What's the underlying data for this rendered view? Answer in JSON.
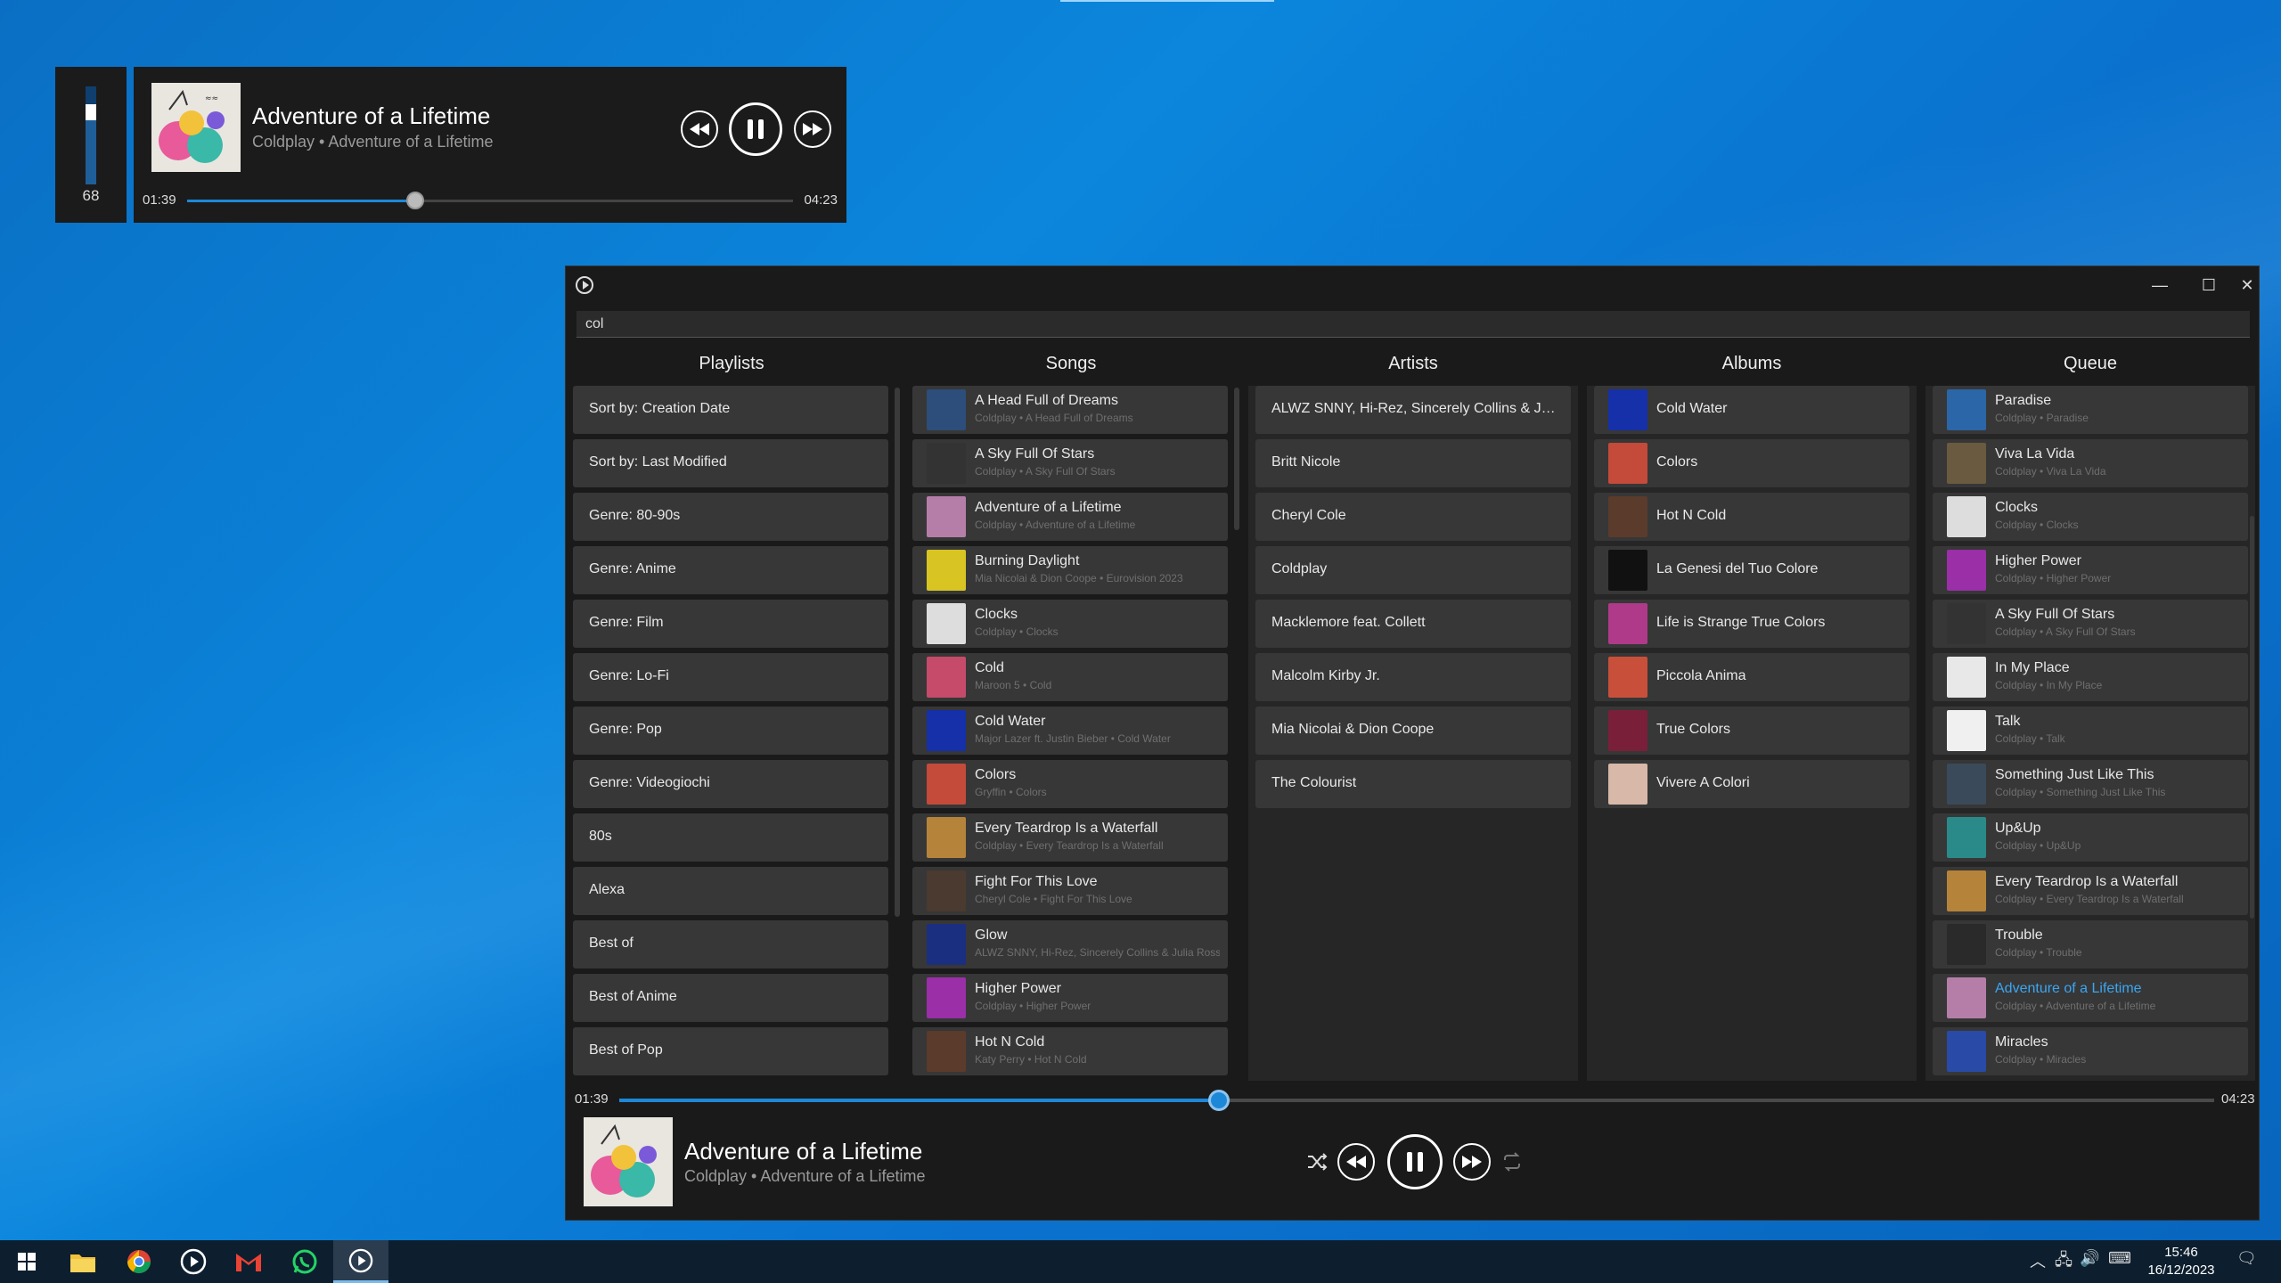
{
  "mini_player": {
    "volume": "68",
    "volume_level": 0.68,
    "title": "Adventure of a Lifetime",
    "subtitle": "Coldplay • Adventure of a Lifetime",
    "elapsed": "01:39",
    "duration": "04:23",
    "progress": 0.376
  },
  "window": {
    "search_value": "col",
    "minimize": "—",
    "maximize": "☐",
    "close": "✕"
  },
  "columns": {
    "playlists": "Playlists",
    "songs": "Songs",
    "artists": "Artists",
    "albums": "Albums",
    "queue": "Queue"
  },
  "playlists": [
    "Sort by: Creation Date",
    "Sort by: Last Modified",
    "Genre: 80-90s",
    "Genre: Anime",
    "Genre: Film",
    "Genre: Lo-Fi",
    "Genre: Pop",
    "Genre: Videogiochi",
    "80s",
    "Alexa",
    "Best of",
    "Best of Anime",
    "Best of Pop"
  ],
  "songs": [
    {
      "title": "A Head Full of Dreams",
      "sub": "Coldplay • A Head Full of Dreams",
      "color": "#2d4d7a"
    },
    {
      "title": "A Sky Full Of Stars",
      "sub": "Coldplay • A Sky Full Of Stars",
      "color": "#333"
    },
    {
      "title": "Adventure of a Lifetime",
      "sub": "Coldplay • Adventure of a Lifetime",
      "color": "#b57ea8"
    },
    {
      "title": "Burning Daylight",
      "sub": "Mia Nicolai & Dion Coope • Eurovision 2023",
      "color": "#d8c422"
    },
    {
      "title": "Clocks",
      "sub": "Coldplay • Clocks",
      "color": "#ddd"
    },
    {
      "title": "Cold",
      "sub": "Maroon 5 • Cold",
      "color": "#c64b6a"
    },
    {
      "title": "Cold Water",
      "sub": "Major Lazer ft. Justin Bieber • Cold Water",
      "color": "#1530a8"
    },
    {
      "title": "Colors",
      "sub": "Gryffin • Colors",
      "color": "#c44a3a"
    },
    {
      "title": "Every Teardrop Is a Waterfall",
      "sub": "Coldplay • Every Teardrop Is a Waterfall",
      "color": "#b5843a"
    },
    {
      "title": "Fight For This Love",
      "sub": "Cheryl Cole • Fight For This Love",
      "color": "#4a3a30"
    },
    {
      "title": "Glow",
      "sub": "ALWZ SNNY, Hi-Rez, Sincerely Collins & Julia Ross • Glow",
      "color": "#1b2f80"
    },
    {
      "title": "Higher Power",
      "sub": "Coldplay • Higher Power",
      "color": "#9a2fa8"
    },
    {
      "title": "Hot N Cold",
      "sub": "Katy Perry • Hot N Cold",
      "color": "#5b3b2b"
    }
  ],
  "artists": [
    "ALWZ SNNY, Hi-Rez, Sincerely Collins & Julia Ro...",
    "Britt Nicole",
    "Cheryl Cole",
    "Coldplay",
    "Macklemore feat. Collett",
    "Malcolm Kirby Jr.",
    "Mia Nicolai & Dion Coope",
    "The Colourist"
  ],
  "albums": [
    {
      "title": "Cold Water",
      "color": "#1530a8"
    },
    {
      "title": "Colors",
      "color": "#c44a3a"
    },
    {
      "title": "Hot N Cold",
      "color": "#5b3b2b"
    },
    {
      "title": "La Genesi del Tuo Colore",
      "color": "#111"
    },
    {
      "title": "Life is Strange True Colors",
      "color": "#b03a8a"
    },
    {
      "title": "Piccola Anima",
      "color": "#c8503a"
    },
    {
      "title": "True Colors",
      "color": "#7a1f3a"
    },
    {
      "title": "Vivere A Colori",
      "color": "#d8b8a8"
    }
  ],
  "queue": [
    {
      "title": "Paradise",
      "sub": "Coldplay • Paradise",
      "color": "#2a66a8",
      "active": false
    },
    {
      "title": "Viva La Vida",
      "sub": "Coldplay • Viva La Vida",
      "color": "#6a5a40",
      "active": false
    },
    {
      "title": "Clocks",
      "sub": "Coldplay • Clocks",
      "color": "#ddd",
      "active": false
    },
    {
      "title": "Higher Power",
      "sub": "Coldplay • Higher Power",
      "color": "#9a2fa8",
      "active": false
    },
    {
      "title": "A Sky Full Of Stars",
      "sub": "Coldplay • A Sky Full Of Stars",
      "color": "#333",
      "active": false
    },
    {
      "title": "In My Place",
      "sub": "Coldplay • In My Place",
      "color": "#e8e8e8",
      "active": false
    },
    {
      "title": "Talk",
      "sub": "Coldplay • Talk",
      "color": "#f0f0f0",
      "active": false
    },
    {
      "title": "Something Just Like This",
      "sub": "Coldplay • Something Just Like This",
      "color": "#3a4a5a",
      "active": false
    },
    {
      "title": "Up&Up",
      "sub": "Coldplay • Up&Up",
      "color": "#2a8a8a",
      "active": false
    },
    {
      "title": "Every Teardrop Is a Waterfall",
      "sub": "Coldplay • Every Teardrop Is a Waterfall",
      "color": "#b5843a",
      "active": false
    },
    {
      "title": "Trouble",
      "sub": "Coldplay • Trouble",
      "color": "#2a2a2a",
      "active": false
    },
    {
      "title": "Adventure of a Lifetime",
      "sub": "Coldplay • Adventure of a Lifetime",
      "color": "#b57ea8",
      "active": true
    },
    {
      "title": "Miracles",
      "sub": "Coldplay • Miracles",
      "color": "#2a4aa8",
      "active": false
    }
  ],
  "player": {
    "elapsed": "01:39",
    "duration": "04:23",
    "progress": 0.376,
    "title": "Adventure of a Lifetime",
    "subtitle": "Coldplay • Adventure of a Lifetime"
  },
  "taskbar": {
    "time": "15:46",
    "date": "16/12/2023"
  },
  "colors": {
    "accent": "#1e88d8",
    "active_text": "#3aa6f2"
  }
}
